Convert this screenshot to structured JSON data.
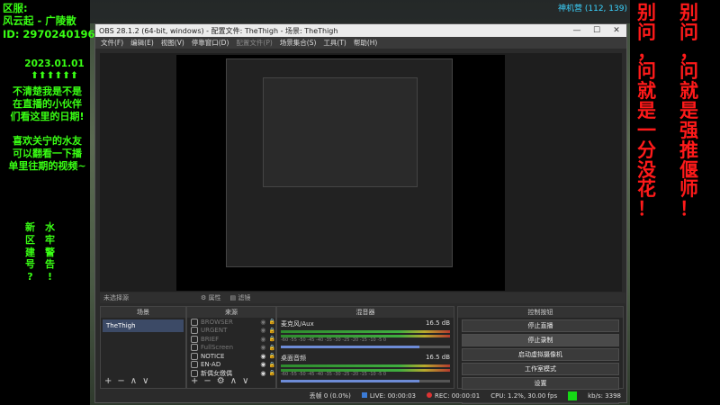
{
  "overlay_left": {
    "line1": "区服:",
    "line2": "风云起 - 广陵散",
    "line3": "ID: 2970240196",
    "date": "2023.01.01",
    "arrows": "⬆⬆⬆⬆⬆⬆",
    "note1": "不清楚我是不是",
    "note2": "在直播的小伙伴",
    "note3": "们看这里的日期!",
    "note4": "喜欢关宁的水友",
    "note5": "可以翻看一下播",
    "note6": "单里往期的视频~",
    "col_left": [
      "新",
      "区",
      "建",
      "号",
      "?"
    ],
    "col_right": [
      "水",
      "牢",
      "警",
      "告",
      "!"
    ]
  },
  "overlay_right": {
    "col1": [
      "别",
      "问",
      "，",
      "问",
      "就",
      "是",
      "一",
      "分",
      "没",
      "花",
      "！"
    ],
    "col2": [
      "别",
      "问",
      "，",
      "问",
      "就",
      "是",
      "强",
      "推",
      "偃",
      "师",
      "！"
    ]
  },
  "game_hud": {
    "text": "神机营 (112, 139)"
  },
  "window": {
    "title": "OBS 28.1.2 (64-bit, windows) - 配置文件: TheThigh - 场景: TheThigh",
    "min": "—",
    "max": "☐",
    "close": "✕"
  },
  "menu": [
    "文件(F)",
    "编辑(E)",
    "视图(V)",
    "停靠窗口(D)",
    "配置文件(P)",
    "场景集合(S)",
    "工具(T)",
    "帮助(H)"
  ],
  "source_bar": {
    "label": "未选择源",
    "props": "属性",
    "filters": "滤镜"
  },
  "scenes": {
    "header": "场景",
    "items": [
      "TheThigh"
    ]
  },
  "sources": {
    "header": "来源",
    "items": [
      {
        "name": "BROWSER",
        "dim": true
      },
      {
        "name": "URGENT",
        "dim": true
      },
      {
        "name": "BRIEF",
        "dim": true
      },
      {
        "name": "FullScreen",
        "dim": true
      },
      {
        "name": "NOTICE",
        "dim": false
      },
      {
        "name": "EN-AD",
        "dim": false
      },
      {
        "name": "新偶女缴偶",
        "dim": false
      }
    ]
  },
  "mixer": {
    "header": "混音器",
    "channels": [
      {
        "name": "麦克风/Aux",
        "db": "16.5 dB",
        "level": 0.82
      },
      {
        "name": "桌面音频",
        "db": "16.5 dB",
        "level": 0.82
      }
    ],
    "ticks": "-60 -55 -50 -45 -40 -35 -30 -25 -20 -15 -10 -5 0"
  },
  "controls": {
    "header": "控制按钮",
    "buttons": [
      "停止直播",
      "停止录制",
      "启动虚拟摄像机",
      "工作室模式",
      "设置",
      "退出"
    ]
  },
  "status": {
    "dropped": "丢帧 0 (0.0%)",
    "live": "LIVE: 00:00:03",
    "rec": "REC: 00:00:01",
    "cpu": "CPU: 1.2%, 30.00 fps",
    "kbs": "kb/s: 3398"
  },
  "footer_icons": {
    "add": "+",
    "remove": "−",
    "up": "∧",
    "down": "∨",
    "gear": "⚙"
  }
}
